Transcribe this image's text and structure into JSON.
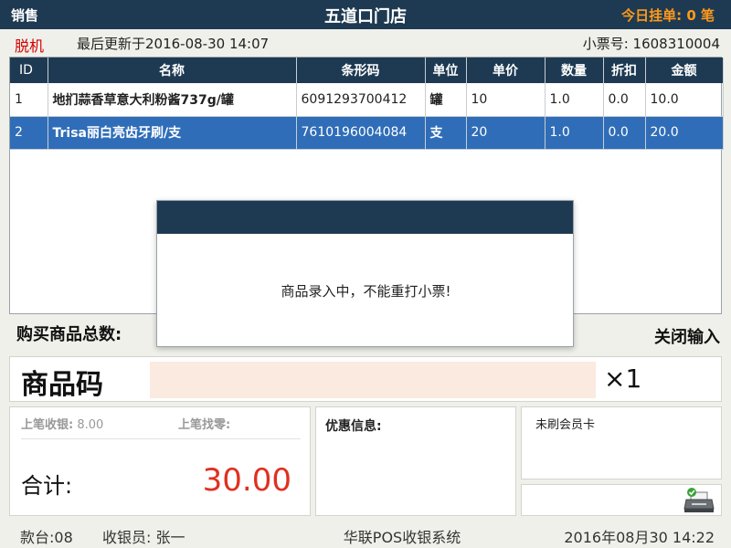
{
  "titlebar": {
    "mode": "销售",
    "store": "五道口门店",
    "held_label": "今日挂单: ",
    "held_count": "0",
    "held_unit": " 笔"
  },
  "status": {
    "offline": "脱机",
    "updated": "最后更新于2016-08-30 14:07",
    "ticket": "小票号: 1608310004"
  },
  "table": {
    "headers": [
      "ID",
      "名称",
      "条形码",
      "单位",
      "单价",
      "数量",
      "折扣",
      "金额"
    ],
    "rows": [
      [
        "1",
        "地扪蒜香草意大利粉酱737g/罐",
        "6091293700412",
        "罐",
        "10",
        "1.0",
        "0.0",
        "10.0"
      ],
      [
        "2",
        "Trisa丽白亮齿牙刷/支",
        "7610196004084",
        "支",
        "20",
        "1.0",
        "0.0",
        "20.0"
      ]
    ]
  },
  "summary": {
    "total_items_label": "购买商品总数:",
    "close_input": "关闭输入"
  },
  "input": {
    "label": "商品码",
    "value": "",
    "qty": "×1"
  },
  "payment": {
    "last_received_label": "上笔收银:",
    "last_received_value": "8.00",
    "last_change_label": "上笔找零:",
    "last_change_value": "",
    "total_label": "合计:",
    "total_value": "30.00"
  },
  "discount": {
    "label": "优惠信息:"
  },
  "member": {
    "label": "未刷会员卡"
  },
  "footer": {
    "station": "款台:08",
    "cashier": "收银员: 张一",
    "system": "华联POS收银系统",
    "datetime": "2016年08月30  14:22"
  },
  "modal": {
    "message": "商品录入中，不能重打小票!"
  },
  "colors": {
    "header": "#1e3a52",
    "selected_row": "#2f6db8",
    "total": "#e03020",
    "held": "#ff9a1a"
  }
}
